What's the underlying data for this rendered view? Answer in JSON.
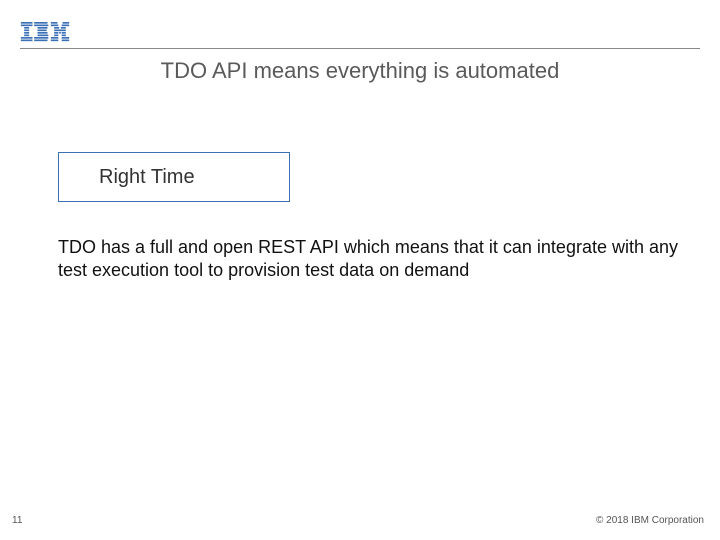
{
  "header": {
    "logo_name": "ibm-logo",
    "title": "TDO API means everything is automated"
  },
  "box": {
    "label": "Right Time"
  },
  "body": {
    "text": "TDO has a full and open REST API which means that it can integrate with any test execution tool to provision test data on demand"
  },
  "footer": {
    "page": "11",
    "copyright": "© 2018 IBM Corporation"
  }
}
